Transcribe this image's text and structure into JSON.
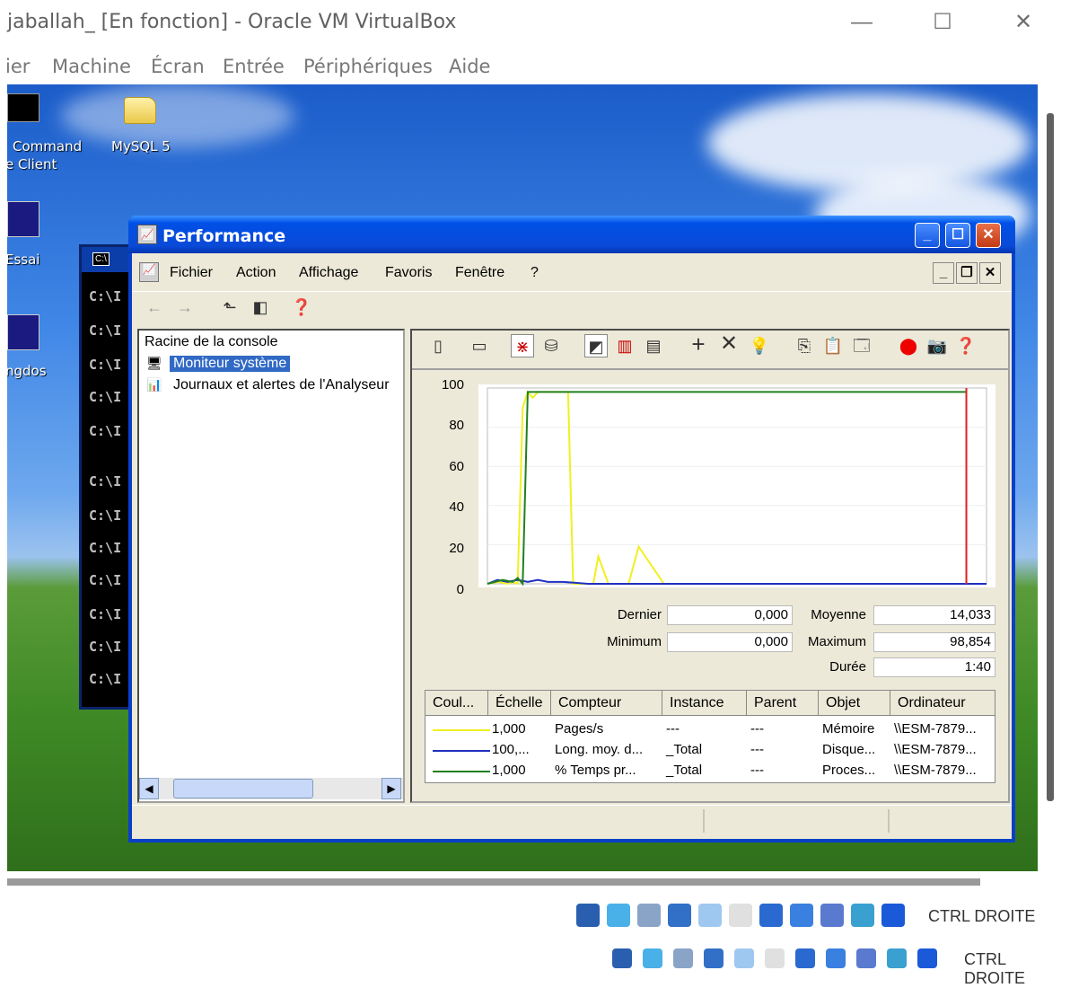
{
  "host": {
    "title": "jaballah_ [En fonction] - Oracle VM VirtualBox",
    "menu": [
      "ier",
      "Machine",
      "Écran",
      "Entrée",
      "Périphériques",
      "Aide"
    ],
    "controls": {
      "minimize": "—",
      "maximize": "☐",
      "close": "✕"
    }
  },
  "desktop": {
    "icons": [
      {
        "label_line1": "Command",
        "label_line2": "e Client"
      },
      {
        "label": "MySQL 5"
      },
      {
        "label": "Essai"
      },
      {
        "label": "ngdos"
      }
    ],
    "cmd_lines": [
      "C:\\I",
      "C:\\I",
      "C:\\I",
      "C:\\I",
      "C:\\I",
      "C:\\I",
      "C:\\I",
      "C:\\I",
      "C:\\I",
      "C:\\I",
      "C:\\I",
      "C:\\I"
    ],
    "cmd_badge": "C:\\"
  },
  "perf_window": {
    "title": "Performance",
    "menu": [
      "Fichier",
      "Action",
      "Affichage",
      "Favoris",
      "Fenêtre",
      "?"
    ],
    "tree": {
      "root": "Racine de la console",
      "items": [
        "Moniteur système",
        "Journaux et alertes de l'Analyseur"
      ]
    },
    "stats": {
      "dernier_label": "Dernier",
      "dernier": "0,000",
      "moyenne_label": "Moyenne",
      "moyenne": "14,033",
      "minimum_label": "Minimum",
      "minimum": "0,000",
      "maximum_label": "Maximum",
      "maximum": "98,854",
      "duree_label": "Durée",
      "duree": "1:40"
    },
    "legend": {
      "headers": [
        "Coul...",
        "Échelle",
        "Compteur",
        "Instance",
        "Parent",
        "Objet",
        "Ordinateur"
      ],
      "rows": [
        {
          "color": "#f0f020",
          "scale": "1,000",
          "counter": "Pages/s",
          "instance": "---",
          "parent": "---",
          "object": "Mémoire",
          "computer": "\\\\ESM-7879..."
        },
        {
          "color": "#2030c0",
          "scale": "100,...",
          "counter": "Long. moy. d...",
          "instance": "_Total",
          "parent": "---",
          "object": "Disque...",
          "computer": "\\\\ESM-7879..."
        },
        {
          "color": "#208020",
          "scale": "1,000",
          "counter": "% Temps pr...",
          "instance": "_Total",
          "parent": "---",
          "object": "Proces...",
          "computer": "\\\\ESM-7879..."
        }
      ]
    }
  },
  "chart_data": {
    "type": "line",
    "ylim": [
      0,
      100
    ],
    "yticks": [
      "100",
      "80",
      "60",
      "40",
      "20",
      "0"
    ],
    "series": [
      {
        "name": "Pages/s",
        "color": "#f0f020",
        "x": [
          0,
          2,
          4,
          5,
          6,
          7,
          8,
          9,
          10,
          11,
          12,
          13,
          15,
          16,
          17,
          18,
          19,
          20,
          21,
          22,
          24,
          26,
          28,
          30,
          35,
          40,
          60,
          80,
          99
        ],
        "values": [
          0,
          1,
          0,
          1,
          0,
          90,
          98,
          95,
          98,
          98,
          98,
          98,
          98,
          98,
          0,
          0,
          0,
          0,
          0,
          14,
          0,
          0,
          0,
          19,
          0,
          0,
          0,
          0,
          0
        ]
      },
      {
        "name": "Long. moy. d...",
        "color": "#2030c0",
        "x": [
          0,
          2,
          4,
          6,
          8,
          10,
          12,
          15,
          20,
          30,
          60,
          99
        ],
        "values": [
          0,
          2,
          1,
          2,
          1,
          2,
          1,
          1,
          0,
          0,
          0,
          0
        ]
      },
      {
        "name": "% Temps pr...",
        "color": "#208020",
        "x": [
          0,
          3,
          5,
          6,
          7,
          8,
          9,
          20,
          40,
          60,
          80,
          94,
          95
        ],
        "values": [
          0,
          2,
          1,
          3,
          0,
          98,
          98,
          98,
          98,
          98,
          98,
          98,
          98
        ]
      }
    ],
    "red_marker_x": 95
  },
  "taskbar": {
    "ctrl_label": "CTRL DROITE"
  }
}
